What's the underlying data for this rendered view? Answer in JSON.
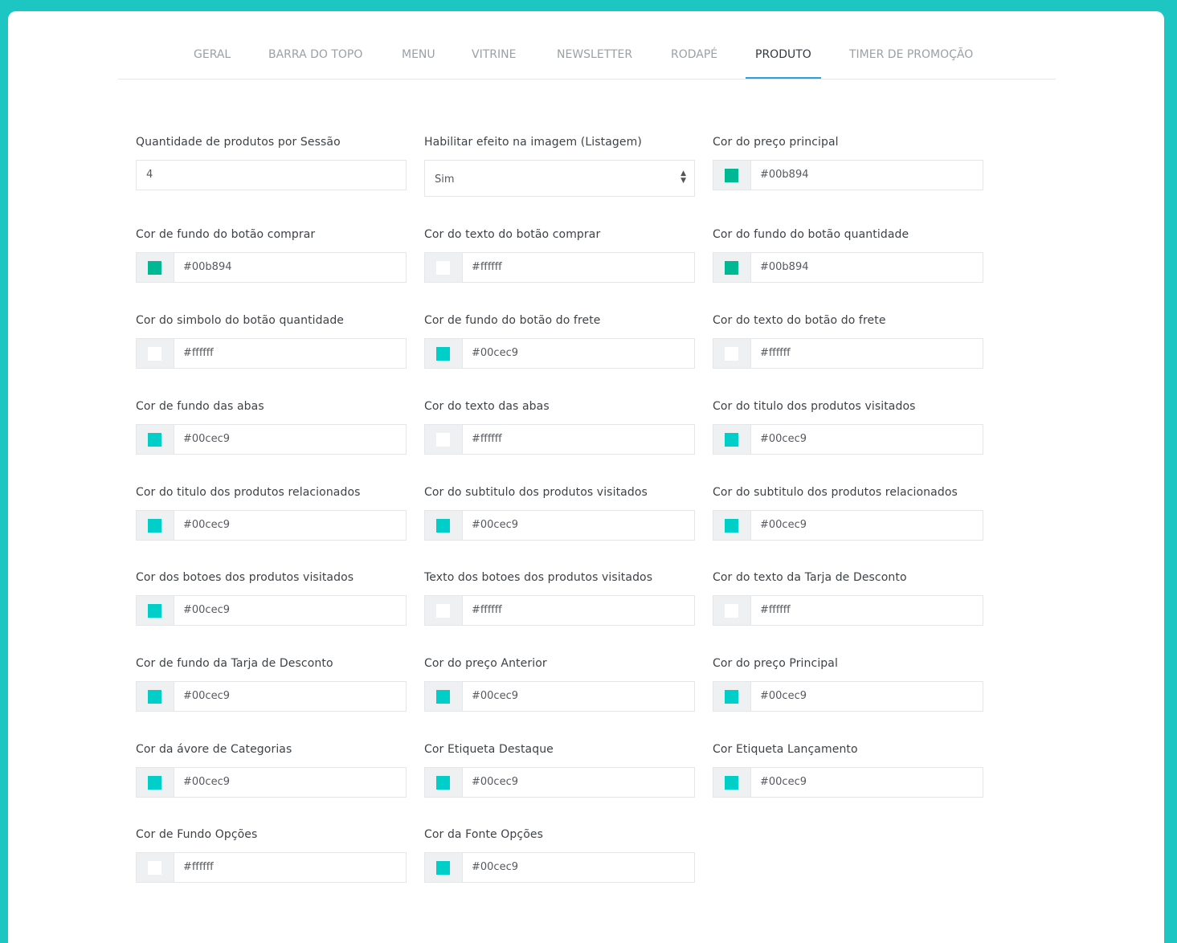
{
  "tabs": [
    "GERAL",
    "BARRA DO TOPO",
    "MENU",
    "VITRINE",
    "NEWSLETTER",
    "RODAPÉ",
    "PRODUTO",
    "TIMER DE PROMOÇÃO"
  ],
  "active_tab": "PRODUTO",
  "fields": {
    "quantidade": {
      "label": "Quantidade de produtos por Sessão",
      "value": "4"
    },
    "efeito": {
      "label": "Habilitar efeito na imagem (Listagem)",
      "value": "Sim"
    },
    "preco_principal": {
      "label": "Cor do preço principal",
      "value": "#00b894"
    },
    "fundo_comprar": {
      "label": "Cor de fundo do botão comprar",
      "value": "#00b894"
    },
    "texto_comprar": {
      "label": "Cor do texto do botão comprar",
      "value": "#ffffff"
    },
    "fundo_quantidade": {
      "label": "Cor do fundo do botão quantidade",
      "value": "#00b894"
    },
    "simbolo_quantidade": {
      "label": "Cor do simbolo do botão quantidade",
      "value": "#ffffff"
    },
    "fundo_frete": {
      "label": "Cor de fundo do botão do frete",
      "value": "#00cec9"
    },
    "texto_frete": {
      "label": "Cor do texto do botão do frete",
      "value": "#ffffff"
    },
    "fundo_abas": {
      "label": "Cor de fundo das abas",
      "value": "#00cec9"
    },
    "texto_abas": {
      "label": "Cor do texto das abas",
      "value": "#ffffff"
    },
    "titulo_visitados": {
      "label": "Cor do titulo dos produtos visitados",
      "value": "#00cec9"
    },
    "titulo_relacionados": {
      "label": "Cor do titulo dos produtos relacionados",
      "value": "#00cec9"
    },
    "subtitulo_visitados": {
      "label": "Cor do subtitulo dos produtos visitados",
      "value": "#00cec9"
    },
    "subtitulo_relacionados": {
      "label": "Cor do subtitulo dos produtos relacionados",
      "value": "#00cec9"
    },
    "botoes_visitados": {
      "label": "Cor dos botoes dos produtos visitados",
      "value": "#00cec9"
    },
    "texto_botoes_visitados": {
      "label": "Texto dos botoes dos produtos visitados",
      "value": "#ffffff"
    },
    "texto_tarja": {
      "label": "Cor do texto da Tarja de Desconto",
      "value": "#ffffff"
    },
    "fundo_tarja": {
      "label": "Cor de fundo da Tarja de Desconto",
      "value": "#00cec9"
    },
    "preco_anterior": {
      "label": "Cor do preço Anterior",
      "value": "#00cec9"
    },
    "preco_principal_2": {
      "label": "Cor do preço Principal",
      "value": "#00cec9"
    },
    "arvore_categorias": {
      "label": "Cor da ávore de Categorias",
      "value": "#00cec9"
    },
    "etiqueta_destaque": {
      "label": "Cor Etiqueta Destaque",
      "value": "#00cec9"
    },
    "etiqueta_lancamento": {
      "label": "Cor Etiqueta Lançamento",
      "value": "#00cec9"
    },
    "fundo_opcoes": {
      "label": "Cor de Fundo Opções",
      "value": "#ffffff"
    },
    "fonte_opcoes": {
      "label": "Cor da Fonte Opções",
      "value": "#00cec9"
    }
  },
  "colors": {
    "frame": "#1dc6c2",
    "active_underline": "#2d9fd9"
  }
}
